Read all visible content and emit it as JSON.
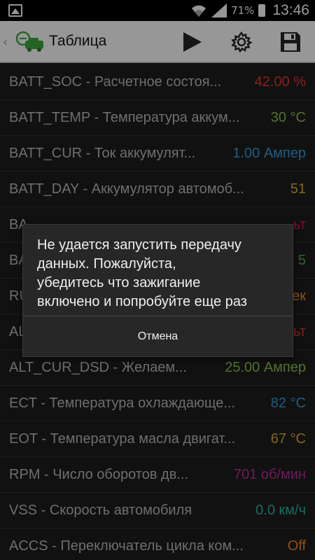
{
  "status_bar": {
    "notification_icon": "image-icon",
    "wifi_icon": "wifi-icon",
    "signal_icon": "signal-icon",
    "battery_percent": "71%",
    "time": "13:46"
  },
  "action_bar": {
    "back_glyph": "‹",
    "title": "Таблица",
    "play_icon": "play-icon",
    "settings_icon": "gear-icon",
    "save_icon": "save-icon"
  },
  "rows": [
    {
      "label": "BATT_SOC - Расчетное состоя...",
      "value": "42.00 %",
      "color": "#d2332a"
    },
    {
      "label": "BATT_TEMP - Температура аккум...",
      "value": "30 °C",
      "color": "#7cb342"
    },
    {
      "label": "BATT_CUR - Ток аккумулят...",
      "value": "1.00 Ампер",
      "color": "#2f8fc9"
    },
    {
      "label": "BATT_DAY - Аккумулятор автомоб...",
      "value": "51",
      "color": "#c9a227"
    },
    {
      "label": "BA",
      "value": "ьт",
      "color": "#c2185b"
    },
    {
      "label": "BA",
      "value": "5",
      "color": "#43a047"
    },
    {
      "label": "RU",
      "value": "ек",
      "color": "#e07b1a"
    },
    {
      "label": "AL",
      "value": "ьт",
      "color": "#d2332a"
    },
    {
      "label": "ALT_CUR_DSD - Желаем...",
      "value": "25.00 Ампер",
      "color": "#7cb342"
    },
    {
      "label": "ECT - Температура охлаждающе...",
      "value": "82 °C",
      "color": "#2f8fc9"
    },
    {
      "label": "EOT - Температура масла двигат...",
      "value": "67 °C",
      "color": "#c9a227"
    },
    {
      "label": "RPM - Число оборотов дв...",
      "value": "701 об/мин",
      "color": "#b0278f"
    },
    {
      "label": "VSS - Скорость автомобиля",
      "value": "0.0 км/ч",
      "color": "#26a69a"
    },
    {
      "label": "ACCS - Переключатель цикла ком...",
      "value": "Off",
      "color": "#e07b1a"
    }
  ],
  "dialog": {
    "message": "Не удается запустить передачу\nданных. Пожалуйста,\n убедитесь что зажигание\nвключено и попробуйте еще раз",
    "cancel_label": "Отмена"
  }
}
